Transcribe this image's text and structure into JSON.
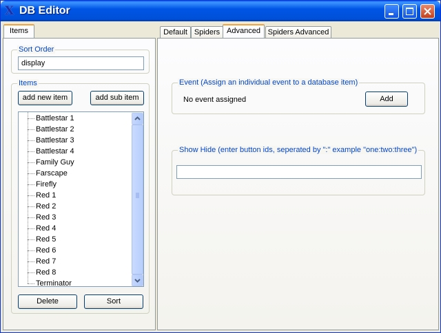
{
  "window": {
    "title": "DB Editor"
  },
  "left_tab": {
    "label": "Items"
  },
  "sort_order": {
    "label": "Sort Order",
    "value": "display"
  },
  "items_group": {
    "label": "Items",
    "add_new_item": "add new item",
    "add_sub_item": "add sub item",
    "delete": "Delete",
    "sort": "Sort",
    "tree_items": [
      "Battlestar 1",
      "Battlestar 2",
      "Battlestar 3",
      "Battlestar 4",
      "Family Guy",
      "Farscape",
      "Firefly",
      "Red 1",
      "Red 2",
      "Red 3",
      "Red 4",
      "Red 5",
      "Red 6",
      "Red 7",
      "Red 8",
      "Terminator"
    ]
  },
  "tabs": [
    {
      "label": "Default",
      "active": false
    },
    {
      "label": "Spiders",
      "active": false
    },
    {
      "label": "Advanced",
      "active": true
    },
    {
      "label": "Spiders Advanced",
      "active": false
    }
  ],
  "event_group": {
    "label": "Event (Assign an individual event to a database item)",
    "status": "No event assigned",
    "add_button": "Add"
  },
  "showhide_group": {
    "label": "Show Hide (enter button ids, seperated by \":\" example \"one:two:three\")",
    "value": ""
  }
}
